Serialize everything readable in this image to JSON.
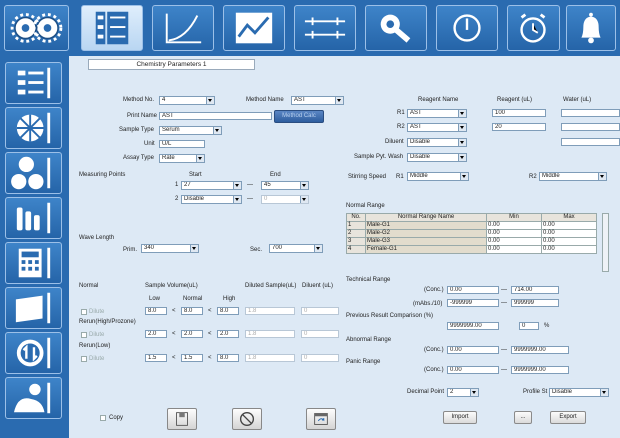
{
  "header": {
    "panel_title": "Chemistry Parameters 1"
  },
  "left": {
    "method_no_label": "Method No.",
    "method_no": "4",
    "method_name_label": "Method Name",
    "method_name": "AST",
    "print_name_label": "Print Name",
    "print_name": "AST",
    "method_calc_label": "Method Calc",
    "sample_type_label": "Sample Type",
    "sample_type": "Serum",
    "unit_label": "Unit",
    "unit": "U/L",
    "assay_type_label": "Assay Type",
    "assay_type": "Rate",
    "measuring_points_label": "Measuring Points",
    "start_label": "Start",
    "end_label": "End",
    "mp_row1_no": "1",
    "mp_row1_start": "27",
    "mp_row1_end": "45",
    "mp_row2_no": "2",
    "mp_row2_start": "Disable",
    "mp_row2_end": "0",
    "wave_length_label": "Wave Length",
    "prim_label": "Prim.",
    "prim_value": "340",
    "sec_label": "Sec.",
    "sec_value": "700",
    "normal_label": "Normal",
    "sample_volume_label": "Sample Volume(uL)",
    "diluted_sample_label": "Diluted Sample(uL)",
    "diluent_label": "Diluent (uL)",
    "low_label": "Low",
    "normal_col_label": "Normal",
    "high_label": "High",
    "dilute_label": "Dilute",
    "row1_low": "8.0",
    "row1_normal": "8.0",
    "row1_high": "8.0",
    "row1_dil_sample": "1.8",
    "row1_diluent": "0",
    "rerun_high_label": "Rerun(High/Prozone)",
    "row2_low": "2.0",
    "row2_normal": "2.0",
    "row2_high": "2.0",
    "row2_dil_sample": "1.8",
    "row2_diluent": "0",
    "rerun_low_label": "Rerun(Low)",
    "row3_low": "1.5",
    "row3_normal": "1.5",
    "row3_high": "8.0",
    "row3_dil_sample": "1.8",
    "row3_diluent": "0",
    "lt": "<",
    "dash": "—",
    "copy_label": "Copy"
  },
  "right": {
    "reagent_name_label": "Reagent Name",
    "reagent_ul_label": "Reagent (uL)",
    "water_ul_label": "Water (uL)",
    "r1_label": "R1",
    "r1_name": "AST",
    "r1_vol": "100",
    "r2_label": "R2",
    "r2_name": "AST",
    "r2_vol": "20",
    "diluent_label": "Diluent",
    "diluent_value": "Disable",
    "sample_pyt_wash_label": "Sample Pyt. Wash",
    "sample_pyt_wash_value": "Disable",
    "stirring_speed_label": "Stirring Speed",
    "stir_r1_label": "R1",
    "stir_r1": "Middle",
    "stir_r2_label": "R2",
    "stir_r2": "Middle",
    "normal_range_label": "Normal Range",
    "nr_headers": [
      "No.",
      "Normal Range Name",
      "Min",
      "Max"
    ],
    "nr_rows": [
      {
        "no": "1",
        "name": "Male-G1",
        "min": "0.00",
        "max": "0.00"
      },
      {
        "no": "2",
        "name": "Male-G2",
        "min": "0.00",
        "max": "0.00"
      },
      {
        "no": "3",
        "name": "Male-G3",
        "min": "0.00",
        "max": "0.00"
      },
      {
        "no": "4",
        "name": "Female-G1",
        "min": "0.00",
        "max": "0.00"
      }
    ],
    "technical_range_label": "Technical Range",
    "conc_label": "(Conc.)",
    "tech_conc_min": "0.00",
    "tech_conc_max": "714.00",
    "abs_label": "(mAbs./10)",
    "tech_abs_min": "-999999",
    "tech_abs_max": "999999",
    "prev_result_label": "Previous Result Comparison (%)",
    "prev_result_value": "9999999.00",
    "prev_pct_value": "0",
    "percent": "%",
    "abnormal_range_label": "Abnormal Range",
    "abn_min": "0.00",
    "abn_max": "9999999.00",
    "panic_range_label": "Panic Range",
    "panic_min": "0.00",
    "panic_max": "9999999.00",
    "decimal_point_label": "Decimal Point",
    "decimal_point": "2",
    "profile_st_label": "Profile St",
    "profile_st": "Disable",
    "import_label": "Import",
    "more_label": "...",
    "export_label": "Export"
  },
  "colors": {
    "chrome": "#2a6bb0",
    "panel": "#dde9f5"
  }
}
